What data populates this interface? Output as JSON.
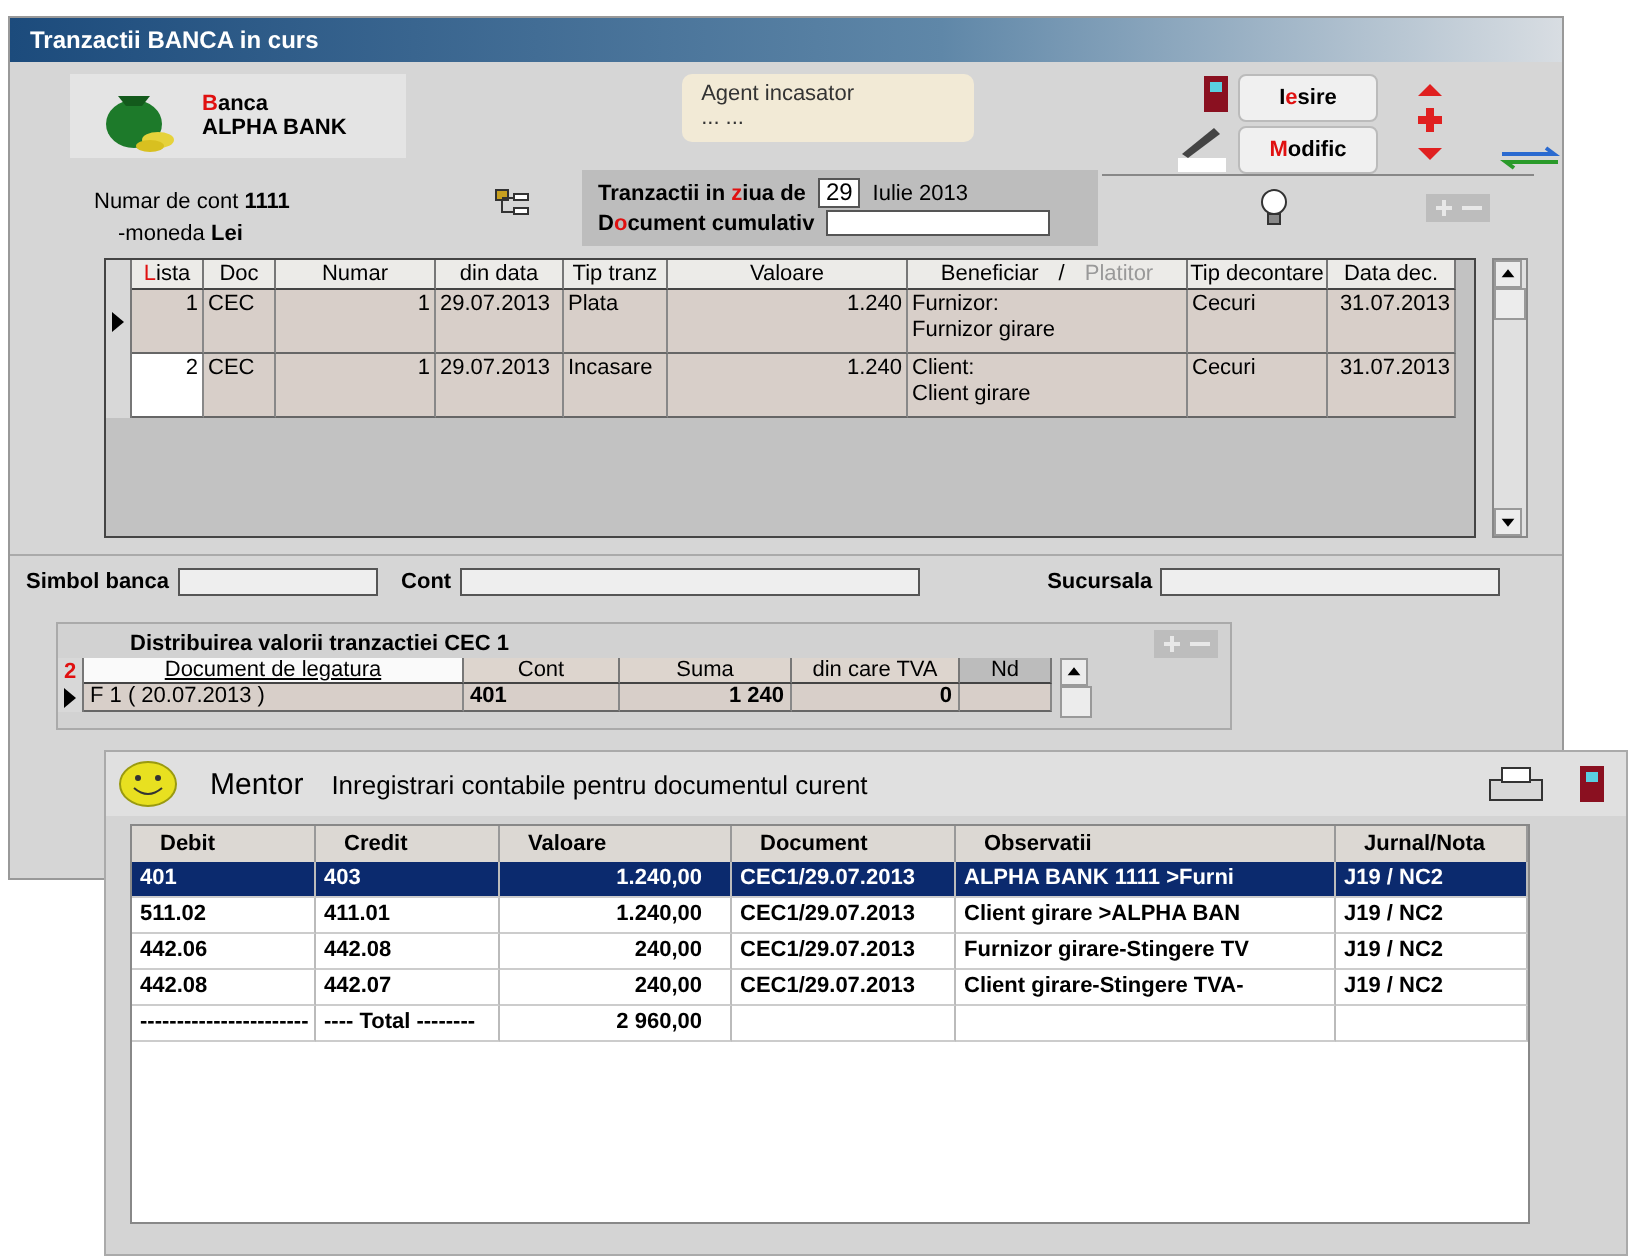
{
  "window": {
    "title": "Tranzactii BANCA in curs"
  },
  "bank": {
    "caption": {
      "key": "B",
      "rest": "anca"
    },
    "name": "ALPHA BANK"
  },
  "agent": {
    "label": "Agent incasator",
    "value": "... ..."
  },
  "buttons": [
    {
      "pre": "I",
      "accent": "e",
      "rest": "sire"
    },
    {
      "accent": "M",
      "rest": "odific"
    }
  ],
  "account": {
    "number_label": "Numar de cont",
    "number": "1111",
    "currency_label": "-moneda",
    "currency": "Lei"
  },
  "day": {
    "label": {
      "pre": "Tranzactii in ",
      "accent": "z",
      "rest": "iua de"
    },
    "day": "29",
    "month_year": "Iulie 2013",
    "cumulative": {
      "pre": "D",
      "accent": "o",
      "rest": "cument cumulativ"
    }
  },
  "add_remove_disabled": true,
  "transactions": {
    "columns": [
      {
        "accent": "L",
        "rest": "ista"
      },
      {
        "pre": "Doc"
      },
      {
        "pre": "Numar"
      },
      {
        "pre": "din data"
      },
      {
        "pre": "Tip tranz"
      },
      {
        "pre": "Valoare"
      },
      {
        "parts": [
          {
            "text": "Beneficiar",
            "disabled": false
          },
          {
            "text": "/",
            "disabled": false
          },
          {
            "text": "Platitor",
            "disabled": true
          }
        ]
      },
      {
        "pre": "Tip decontare"
      },
      {
        "pre": "Data dec."
      }
    ],
    "rows": [
      {
        "current": true,
        "lista": "1",
        "doc": "CEC",
        "numar": "1",
        "din_data": "29.07.2013",
        "tip": "Plata",
        "valoare": "1.240",
        "party": [
          "Furnizor:",
          "Furnizor girare"
        ],
        "tip_decontare": "Cecuri",
        "data_dec": "31.07.2013"
      },
      {
        "current": false,
        "lista": "2",
        "doc": "CEC",
        "numar": "1",
        "din_data": "29.07.2013",
        "tip": "Incasare",
        "valoare": "1.240",
        "party": [
          "Client:",
          "Client girare"
        ],
        "tip_decontare": "Cecuri",
        "data_dec": "31.07.2013"
      }
    ]
  },
  "bank_fields": [
    {
      "label": "Simbol banca"
    },
    {
      "label": "Cont"
    },
    {
      "label": "Sucursala"
    }
  ],
  "distribution": {
    "title": "Distribuirea valorii tranzactiei CEC 1",
    "marker": "2",
    "columns": [
      "Document de legatura",
      "Cont",
      "Suma",
      "din care TVA",
      "Nd"
    ],
    "rows": [
      {
        "current": true,
        "cells": [
          "F 1 ( 20.07.2013 )",
          "401",
          "1 240",
          "0",
          ""
        ]
      }
    ]
  },
  "mentor": {
    "brand": "Mentor",
    "title": "Inregistrari contabile pentru documentul curent",
    "columns": [
      "Debit",
      "Credit",
      "Valoare",
      "Document",
      "Observatii",
      "Jurnal/Nota"
    ],
    "rows": [
      {
        "selected": true,
        "cells": [
          "401",
          "403",
          "1.240,00",
          "CEC1/29.07.2013",
          "ALPHA BANK 1111 >Furni",
          "J19 / NC2"
        ]
      },
      {
        "selected": false,
        "cells": [
          "511.02",
          "411.01",
          "1.240,00",
          "CEC1/29.07.2013",
          "Client girare >ALPHA BAN",
          "J19 / NC2"
        ]
      },
      {
        "selected": false,
        "cells": [
          "442.06",
          "442.08",
          "240,00",
          "CEC1/29.07.2013",
          "Furnizor girare-Stingere TV",
          "J19 / NC2"
        ]
      },
      {
        "selected": false,
        "cells": [
          "442.08",
          "442.07",
          "240,00",
          "CEC1/29.07.2013",
          "Client girare-Stingere TVA-",
          "J19 / NC2"
        ]
      }
    ],
    "total": [
      "-----------------------",
      "---- Total --------",
      "2 960,00"
    ]
  }
}
